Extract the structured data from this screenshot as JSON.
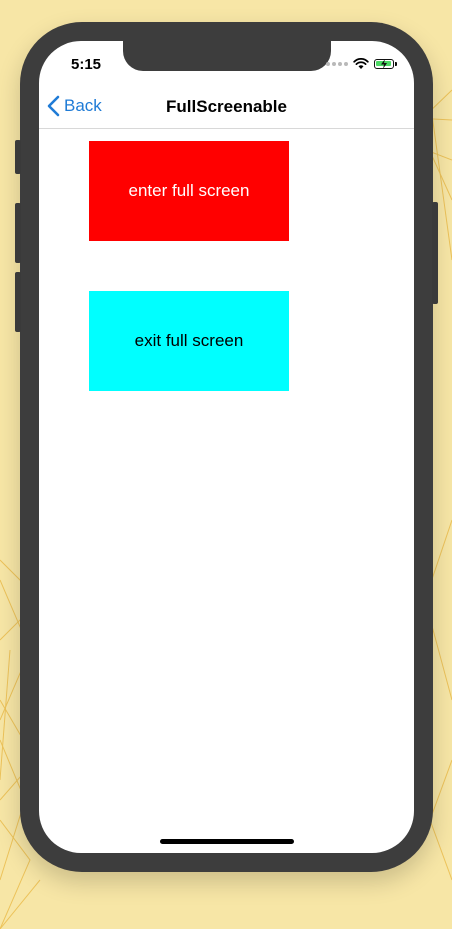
{
  "status_bar": {
    "time": "5:15"
  },
  "nav_bar": {
    "back_label": "Back",
    "title": "FullScreenable"
  },
  "buttons": {
    "enter": {
      "label": "enter full screen",
      "bg_color": "#ff0000",
      "text_color": "#ffffff"
    },
    "exit": {
      "label": "exit full screen",
      "bg_color": "#00ffff",
      "text_color": "#000000"
    }
  },
  "colors": {
    "accent": "#1f7bd6",
    "background": "#f7e6a6",
    "device_frame": "#3d3d3d"
  },
  "icons": {
    "back": "chevron-left-icon",
    "wifi": "wifi-icon",
    "battery": "battery-charging-icon",
    "signal": "signal-icon"
  }
}
